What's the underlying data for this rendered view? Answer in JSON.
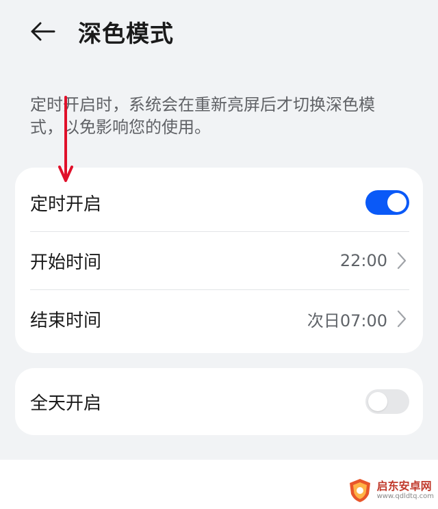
{
  "header": {
    "title": "深色模式",
    "back_icon": "arrow-left-icon"
  },
  "description": "定时开启时，系统会在重新亮屏后才切换深色模式，以免影响您的使用。",
  "schedule_card": {
    "scheduled": {
      "label": "定时开启",
      "enabled": true
    },
    "start_time": {
      "label": "开始时间",
      "value": "22:00"
    },
    "end_time": {
      "label": "结束时间",
      "value": "次日07:00"
    }
  },
  "allday_card": {
    "all_day": {
      "label": "全天开启",
      "enabled": false
    }
  },
  "watermark": {
    "title": "启东安卓网",
    "url": "www.qdldtq.com"
  },
  "colors": {
    "accent": "#0a59f7",
    "background": "#f1f3f5",
    "card": "#ffffff",
    "annotation_arrow": "#e0102a"
  }
}
